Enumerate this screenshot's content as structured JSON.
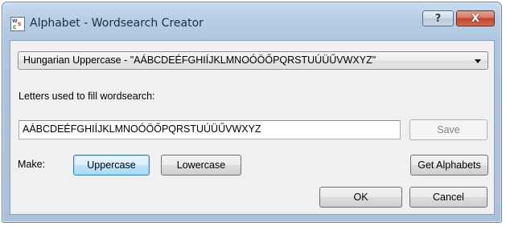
{
  "window": {
    "title": "Alphabet - Wordsearch Creator",
    "icon": "app-icon",
    "help_glyph": "?",
    "close_glyph": "X"
  },
  "alphabet_select": {
    "value": "Hungarian Uppercase - \"AÁBCDEÉFGHIÍJKLMNOÓÖŐPQRSTUÚÜŰVWXYZ\""
  },
  "letters": {
    "label": "Letters used to fill wordsearch:",
    "value": "AÁBCDEÉFGHIÍJKLMNOÓÖŐPQRSTUÚÜŰVWXYZ"
  },
  "buttons": {
    "save": "Save",
    "uppercase": "Uppercase",
    "lowercase": "Lowercase",
    "get_alphabets": "Get Alphabets",
    "ok": "OK",
    "cancel": "Cancel"
  },
  "make": {
    "label": "Make:"
  },
  "colors": {
    "titlebar": "#b8cfe6",
    "close_button": "#c3452b",
    "active_button": "#bee6fd",
    "client_background": "#f0f0f0"
  }
}
